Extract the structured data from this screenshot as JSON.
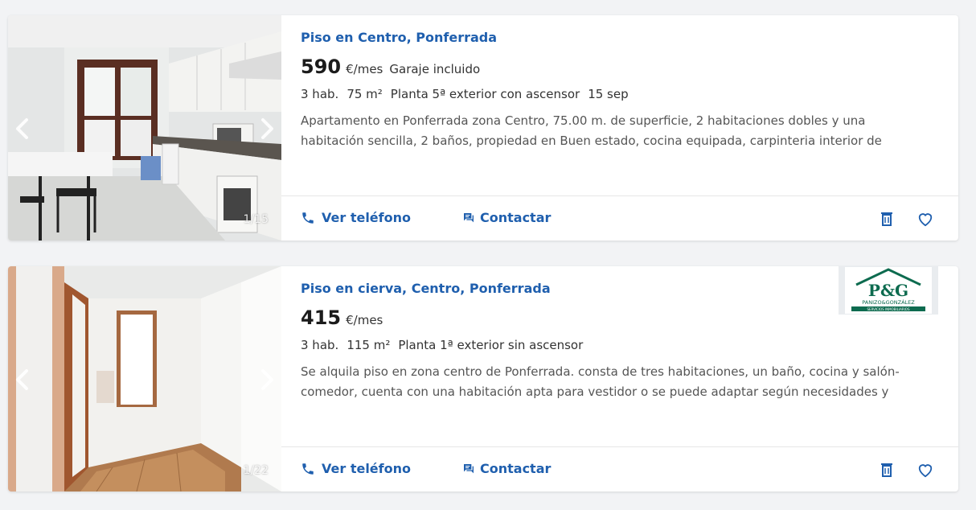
{
  "listings": [
    {
      "title": "Piso en Centro, Ponferrada",
      "price": "590",
      "price_unit": "€/mes",
      "price_extra": "Garaje incluido",
      "details": [
        "3 hab.",
        "75 m²",
        "Planta 5ª exterior con ascensor",
        "15 sep"
      ],
      "description": "Apartamento en Ponferrada zona Centro, 75.00 m. de superficie, 2 habitaciones dobles y una habitación sencilla, 2 baños, propiedad en Buen estado, cocina equipada, carpinteria interior de madera, orientación...",
      "photo_counter": "1/15",
      "phone_label": "Ver teléfono",
      "contact_label": "Contactar"
    },
    {
      "title": "Piso en cierva, Centro, Ponferrada",
      "price": "415",
      "price_unit": "€/mes",
      "details": [
        "3 hab.",
        "115 m²",
        "Planta 1ª exterior sin ascensor"
      ],
      "description": "Se alquila piso en zona centro de Ponferrada. consta de tres habitaciones, un baño, cocina y salón-comedor, cuenta con una habitación apta para vestidor o se puede adaptar según necesidades y también tiene un...",
      "photo_counter": "1/22",
      "phone_label": "Ver teléfono",
      "contact_label": "Contactar",
      "agency_logo": {
        "text": "P&G",
        "subtext": "PANIZO&GONZÁLEZ",
        "tagline": "SERVICIOS INMOBILIARIOS"
      }
    }
  ],
  "colors": {
    "link": "#1f5fae",
    "logo_green": "#0d6b4f"
  }
}
